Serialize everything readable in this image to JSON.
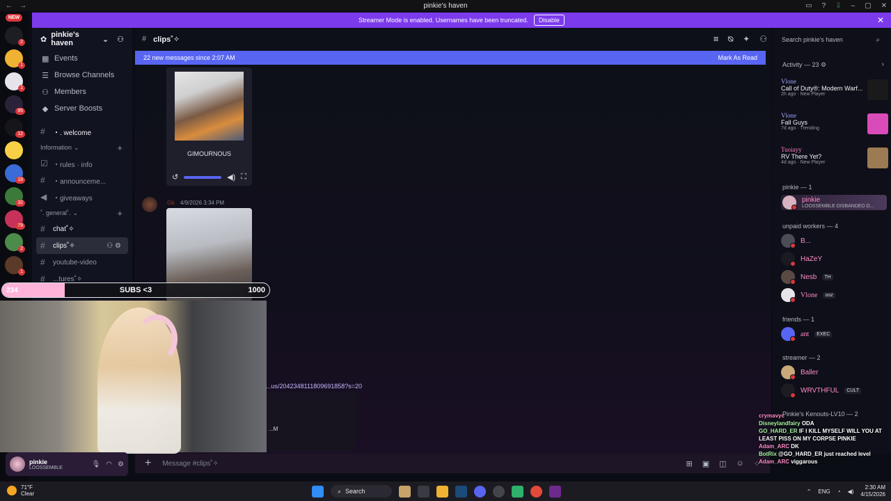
{
  "window": {
    "title": "pinkie's haven"
  },
  "banner": {
    "text": "Streamer Mode is enabled. Usernames have been truncated.",
    "button": "Disable"
  },
  "rail": {
    "new_badge": "NEW",
    "servers": [
      {
        "badge": "2",
        "color": "#1d1e24"
      },
      {
        "badge": "1",
        "color": "#f0b232"
      },
      {
        "badge": "1",
        "color": "#e7e3ea"
      },
      {
        "badge": "95",
        "color": "#2a2238"
      },
      {
        "badge": "12",
        "color": "#15151a"
      },
      {
        "badge": "",
        "color": "#f7d046"
      },
      {
        "badge": "18",
        "color": "#3a6bd6"
      },
      {
        "badge": "32",
        "color": "#3c7a3a"
      },
      {
        "badge": "79",
        "color": "#c8325a"
      },
      {
        "badge": "2",
        "color": "#4c8b4a"
      },
      {
        "badge": "1",
        "color": "#5a3a28"
      }
    ]
  },
  "sidebar": {
    "server_name": "pinkie's haven",
    "nav": [
      {
        "label": "Events",
        "icon": "▦"
      },
      {
        "label": "Browse Channels",
        "icon": "☰"
      },
      {
        "label": "Members",
        "icon": "👥"
      },
      {
        "label": "Server Boosts",
        "icon": "◆"
      }
    ],
    "welcome": "・. welcome",
    "cat_information": "Information",
    "info_channels": [
      "・rules · info",
      "・announceme...",
      "・giveaways"
    ],
    "cat_general": "˚. general˚.",
    "general_channels": [
      "chat˚✧",
      "clips˚✧",
      "youtube-video",
      "...tures˚✧"
    ]
  },
  "chat": {
    "channel": "clips˚✧",
    "new_messages": "22 new messages since 2:07 AM",
    "mark_read": "Mark As Read",
    "media1_caption": "GIMOURNOUS",
    "msg2_author": "Gb",
    "msg2_time": "4/9/2026 3:34 PM",
    "link_text": "...us/2042348111809691858?s=20",
    "embed_time": "...M",
    "composer_placeholder": "Message #clips˚✧"
  },
  "user_panel": {
    "name": "pinkie",
    "status": "LOOSSEMBLE"
  },
  "members": {
    "search_placeholder": "Search pinkie's haven",
    "activity_header": "Activity — 23",
    "activities": [
      {
        "who": "Vlone",
        "game": "Call of Duty®: Modern Warf...",
        "sub": "2h ago · New Player",
        "thumb_color": "#1a1a1a"
      },
      {
        "who": "Vlone",
        "game": "Fall Guys",
        "sub": "7d ago · Trending",
        "thumb_color": "#d94bb8"
      },
      {
        "who": "Tuoiayy",
        "game": "RV There Yet?",
        "sub": "4d ago · New Player",
        "thumb_color": "#9c7a52"
      }
    ],
    "groups": {
      "pinkie": "pinkie — 1",
      "unpaid": "unpaid workers — 4",
      "friends": "friends — 1",
      "streamer": "streamer — 2",
      "kenkouts": "Pinkie's Kenouts-LV10 — 2"
    },
    "pinkie_member": {
      "name": "pinkie",
      "sub": "LOOSSEMBLE DISBANDED D..."
    },
    "unpaid": [
      {
        "name": "B...",
        "tag": ""
      },
      {
        "name": "HaZeY",
        "tag": ""
      },
      {
        "name": "Nesb",
        "tag": "TH"
      },
      {
        "name": "Vlone",
        "tag": "ooz"
      }
    ],
    "friends": [
      {
        "name": "ant",
        "tag": "EXEC"
      }
    ],
    "streamers": [
      {
        "name": "Baller",
        "tag": ""
      },
      {
        "name": "WRVTHFUL",
        "tag": "CULT"
      }
    ]
  },
  "stream": {
    "sub_current": "234",
    "sub_label": "SUBS <3",
    "sub_goal": "1000",
    "sub_progress": 0.234,
    "chat": [
      {
        "user": "crymavyc",
        "text": ""
      },
      {
        "user": "Disneylandfairy",
        "text": "ODA"
      },
      {
        "user": "GO_HARD_ER",
        "text": "IF I KILL MYSELF WILL YOU AT LEAST PISS ON MY CORPSE PINKIE"
      },
      {
        "user": "Adam_ARC",
        "text": "DK"
      },
      {
        "user": "BotRix",
        "text": "@GO_HARD_ER just reached level"
      },
      {
        "user": "Adam_ARC",
        "text": "viggarous"
      }
    ]
  },
  "taskbar": {
    "temp": "71°F",
    "weather": "Clear",
    "search": "Search",
    "lang": "ENG",
    "time": "2:30 AM",
    "date": "4/15/2026"
  }
}
